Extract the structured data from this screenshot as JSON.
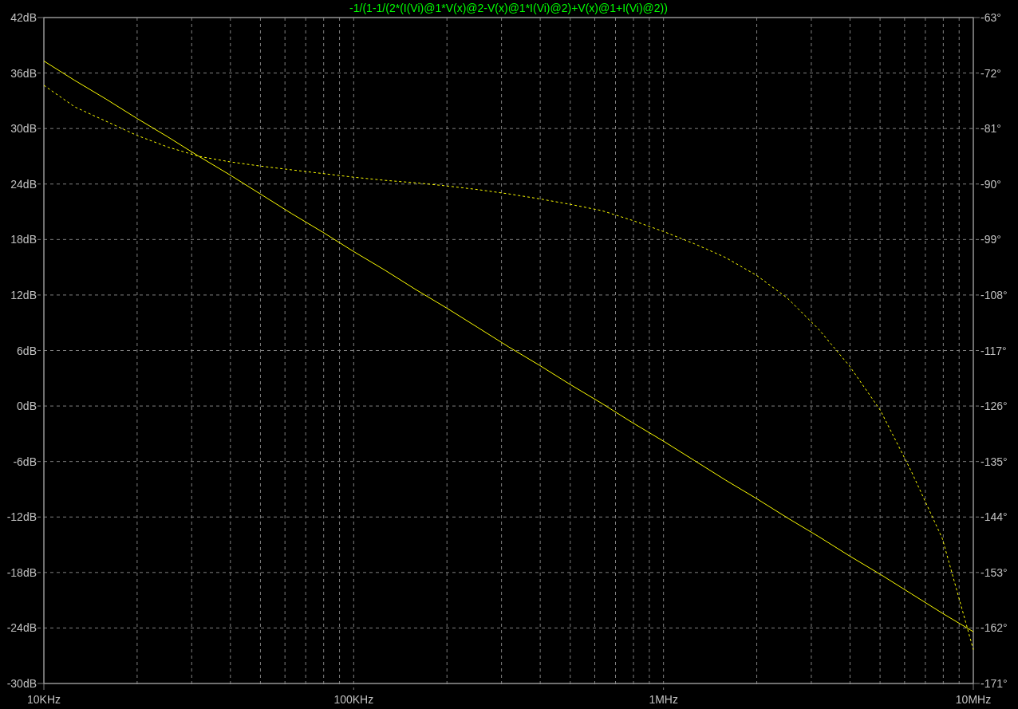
{
  "plot": {
    "chart_data": {
      "type": "line",
      "title": "-1/(1-1/(2*(I(Vi)@1*V(x)@2-V(x)@1*I(Vi)@2)+V(x)@1+I(Vi)@2))",
      "categories": [
        "10KHz",
        null,
        null,
        null,
        null,
        null,
        null,
        null,
        null,
        null,
        "100KHz",
        null,
        null,
        null,
        null,
        null,
        null,
        null,
        null,
        null,
        "1MHz",
        null,
        null,
        null,
        null,
        null,
        null,
        null,
        null,
        null,
        "10MHz"
      ],
      "grid": true,
      "ylim": [
        -30,
        42
      ],
      "yticks": [
        {
          "value": 42,
          "label": "42dB"
        },
        {
          "value": 36,
          "label": "36dB"
        },
        {
          "value": 30,
          "label": "30dB"
        },
        {
          "value": 24,
          "label": "24dB"
        },
        {
          "value": 18,
          "label": "18dB"
        },
        {
          "value": 12,
          "label": "12dB"
        },
        {
          "value": 6,
          "label": "6dB"
        },
        {
          "value": 0,
          "label": "0dB"
        },
        {
          "value": -6,
          "label": "-6dB"
        },
        {
          "value": -12,
          "label": "-12dB"
        },
        {
          "value": -18,
          "label": "-18dB"
        },
        {
          "value": -24,
          "label": "-24dB"
        },
        {
          "value": -30,
          "label": "-30dB"
        }
      ],
      "y2lim": [
        -171,
        -63
      ],
      "y2ticks": [
        {
          "value": -63,
          "label": "-63°"
        },
        {
          "value": -72,
          "label": "-72°"
        },
        {
          "value": -81,
          "label": "-81°"
        },
        {
          "value": -90,
          "label": "-90°"
        },
        {
          "value": -99,
          "label": "-99°"
        },
        {
          "value": -108,
          "label": "-108°"
        },
        {
          "value": -117,
          "label": "-117°"
        },
        {
          "value": -126,
          "label": "-126°"
        },
        {
          "value": -135,
          "label": "-135°"
        },
        {
          "value": -144,
          "label": "-144°"
        },
        {
          "value": -153,
          "label": "-153°"
        },
        {
          "value": -162,
          "label": "-162°"
        },
        {
          "value": -171,
          "label": "-171°"
        }
      ],
      "series": [
        {
          "color": "#ffff00",
          "values": [
            37.3,
            35.2,
            33.2,
            31.1,
            29.1,
            27.0,
            25.0,
            22.9,
            20.8,
            18.8,
            16.7,
            14.7,
            12.6,
            10.6,
            8.5,
            6.4,
            4.4,
            2.3,
            0.3,
            -1.8,
            -3.8,
            -5.9,
            -8.0,
            -10.0,
            -12.1,
            -14.1,
            -16.2,
            -18.2,
            -20.3,
            -22.4,
            -24.4
          ]
        },
        {
          "axis": "y2",
          "line_style": "dashed",
          "color": "#ffff00",
          "values": [
            -74.0,
            -77.5,
            -79.8,
            -82.1,
            -84.0,
            -85.5,
            -86.4,
            -87.1,
            -87.7,
            -88.3,
            -88.9,
            -89.4,
            -89.8,
            -90.3,
            -90.9,
            -91.6,
            -92.4,
            -93.3,
            -94.3,
            -95.9,
            -97.7,
            -99.7,
            -101.9,
            -104.8,
            -108.5,
            -113.5,
            -119.5,
            -126.7,
            -136.6,
            -147.5,
            -165.5
          ]
        }
      ]
    }
  }
}
